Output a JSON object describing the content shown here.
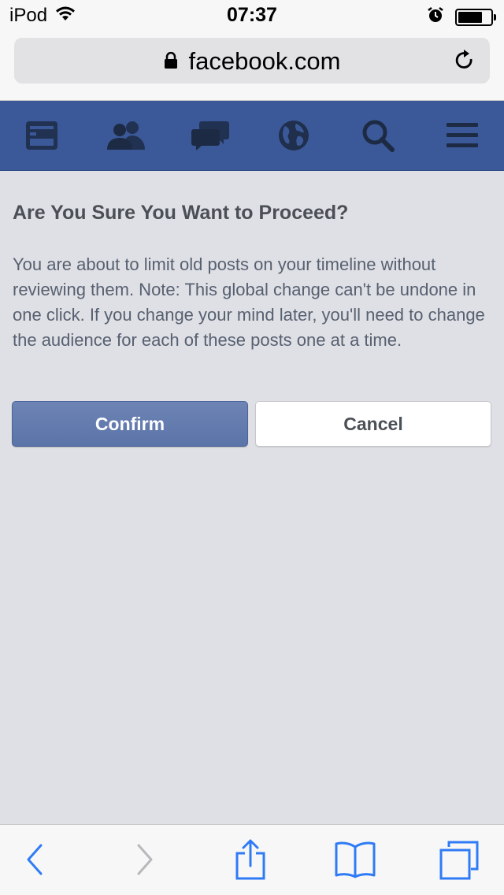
{
  "status_bar": {
    "carrier": "iPod",
    "time": "07:37",
    "icons": [
      "wifi-icon",
      "alarm-icon",
      "battery-icon"
    ]
  },
  "browser": {
    "url": "facebook.com",
    "icons": [
      "lock-icon",
      "reload-icon"
    ]
  },
  "fb_nav": {
    "background": "#3b5998",
    "items": [
      "news-feed-icon",
      "friends-icon",
      "messages-icon",
      "notifications-globe-icon",
      "search-icon",
      "menu-icon"
    ]
  },
  "dialog": {
    "title": "Are You Sure You Want to Proceed?",
    "body": "You are about to limit old posts on your timeline without reviewing them. Note: This global change can't be undone in one click. If you change your mind later, you'll need to change the audience for each of these posts one at a time.",
    "confirm_label": "Confirm",
    "cancel_label": "Cancel"
  },
  "toolbar": {
    "items": [
      "back-icon",
      "forward-icon",
      "share-icon",
      "bookmarks-icon",
      "tabs-icon"
    ],
    "accent": "#2f7bf6"
  }
}
